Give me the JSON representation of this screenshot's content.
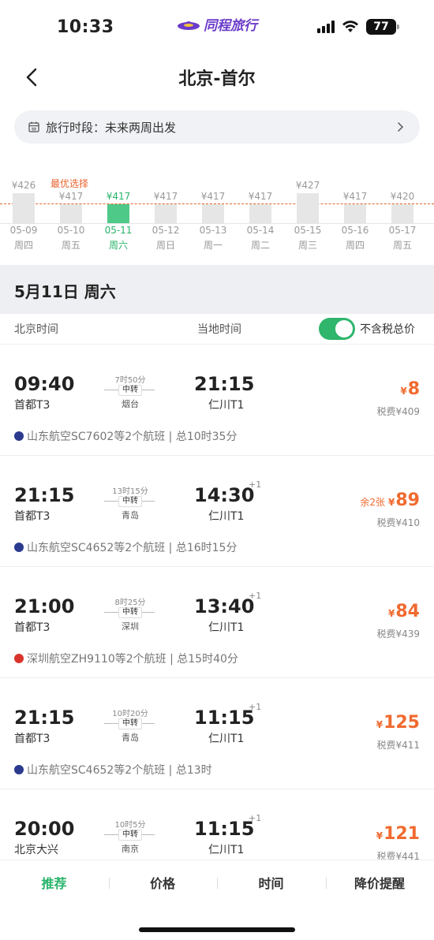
{
  "status": {
    "time": "10:33",
    "battery": "77"
  },
  "brand": {
    "name": "同程旅行",
    "color": "#6b3cc9"
  },
  "nav": {
    "title": "北京-首尔"
  },
  "period": {
    "label": "旅行时段：未来两周出发"
  },
  "calendar": {
    "best_label": "最优选择",
    "days": [
      {
        "price": "¥426",
        "date": "05-09",
        "week": "周四",
        "active": false
      },
      {
        "price": "¥417",
        "date": "05-10",
        "week": "周五",
        "active": false
      },
      {
        "price": "¥417",
        "date": "05-11",
        "week": "周六",
        "active": true
      },
      {
        "price": "¥417",
        "date": "05-12",
        "week": "周日",
        "active": false
      },
      {
        "price": "¥417",
        "date": "05-13",
        "week": "周一",
        "active": false
      },
      {
        "price": "¥417",
        "date": "05-14",
        "week": "周二",
        "active": false
      },
      {
        "price": "¥427",
        "date": "05-15",
        "week": "周三",
        "active": false
      },
      {
        "price": "¥417",
        "date": "05-16",
        "week": "周四",
        "active": false
      },
      {
        "price": "¥420",
        "date": "05-17",
        "week": "周五",
        "active": false
      }
    ]
  },
  "date_header": "5月11日 周六",
  "columns": {
    "beijing": "北京时间",
    "local": "当地时间",
    "tax_toggle": "不含税总价",
    "toggle_on": true
  },
  "flights": [
    {
      "dep_time": "09:40",
      "dep_apt": "首都T3",
      "duration": "7时50分",
      "transfer": "中转",
      "city": "烟台",
      "arr_time": "21:15",
      "plus": "",
      "arr_apt": "仁川T1",
      "price": "8",
      "remain": "",
      "tax": "税费¥409",
      "airline": "山东航空SC7602等2个航班 | 总10时35分",
      "airline_color": "#2b3a8f"
    },
    {
      "dep_time": "21:15",
      "dep_apt": "首都T3",
      "duration": "13时15分",
      "transfer": "中转",
      "city": "青岛",
      "arr_time": "14:30",
      "plus": "+1",
      "arr_apt": "仁川T1",
      "price": "89",
      "remain": "余2张",
      "tax": "税费¥410",
      "airline": "山东航空SC4652等2个航班 | 总16时15分",
      "airline_color": "#2b3a8f"
    },
    {
      "dep_time": "21:00",
      "dep_apt": "首都T3",
      "duration": "8时25分",
      "transfer": "中转",
      "city": "深圳",
      "arr_time": "13:40",
      "plus": "+1",
      "arr_apt": "仁川T1",
      "price": "84",
      "remain": "",
      "tax": "税费¥439",
      "airline": "深圳航空ZH9110等2个航班 | 总15时40分",
      "airline_color": "#d8342c"
    },
    {
      "dep_time": "21:15",
      "dep_apt": "首都T3",
      "duration": "10时20分",
      "transfer": "中转",
      "city": "青岛",
      "arr_time": "11:15",
      "plus": "+1",
      "arr_apt": "仁川T1",
      "price": "125",
      "remain": "",
      "tax": "税费¥411",
      "airline": "山东航空SC4652等2个航班 | 总13时",
      "airline_color": "#2b3a8f"
    },
    {
      "dep_time": "20:00",
      "dep_apt": "北京大兴",
      "duration": "10时5分",
      "transfer": "中转",
      "city": "南京",
      "arr_time": "11:15",
      "plus": "+1",
      "arr_apt": "仁川T1",
      "price": "121",
      "remain": "",
      "tax": "税费¥441",
      "airline": "",
      "airline_color": "#2b3a8f"
    }
  ],
  "bottom_tabs": [
    {
      "label": "推荐",
      "active": true
    },
    {
      "label": "价格",
      "active": false
    },
    {
      "label": "时间",
      "active": false
    },
    {
      "label": "降价提醒",
      "active": false
    }
  ],
  "colors": {
    "accent_green": "#28b36a",
    "price_orange": "#f06a2f"
  }
}
